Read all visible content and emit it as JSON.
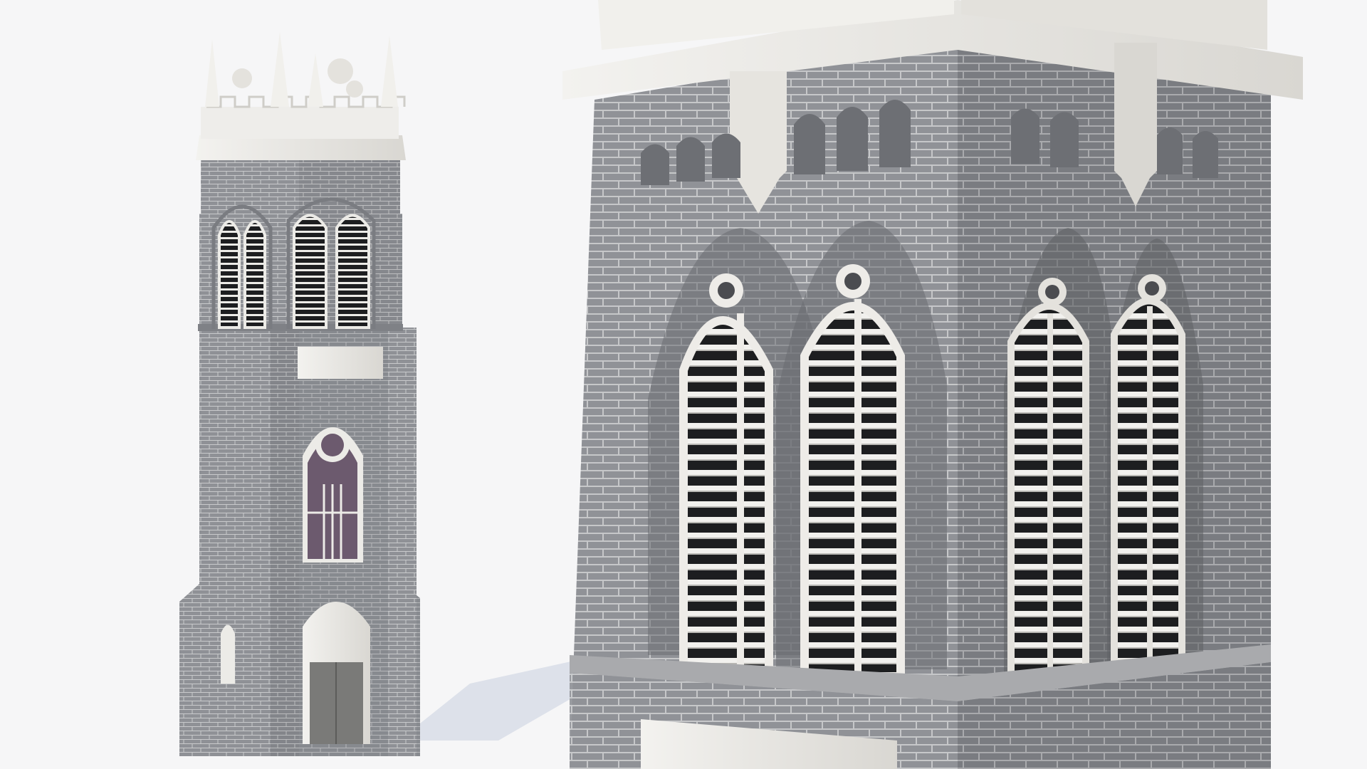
{
  "scene": {
    "subject": "gothic-bell-tower-render",
    "views": [
      "full-tower-view",
      "belfry-closeup-view"
    ],
    "colors": {
      "background": "#f6f6f7",
      "brick": "#8f9196",
      "brick_dark": "#6f7277",
      "mortar": "#c9cacc",
      "stone_trim": "#e9e7e3",
      "stone_shadow": "#c8c6c1",
      "louver_dark": "#1d1e20",
      "louver_slat": "#f2f1ee",
      "shadow": "#dde1ea",
      "door": "#7a7a78",
      "stained_glass": "#6c5a6e"
    }
  }
}
